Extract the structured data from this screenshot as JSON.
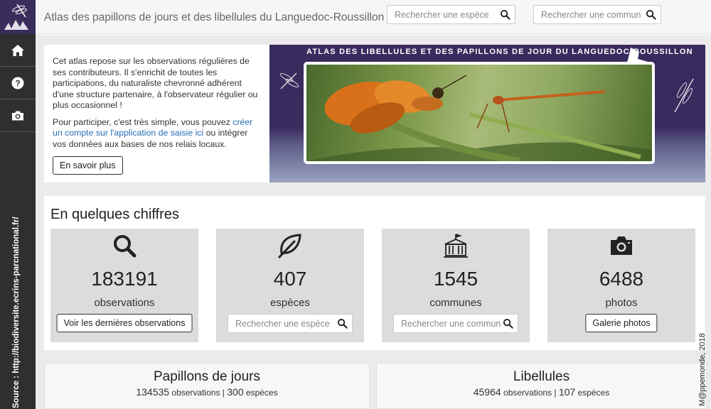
{
  "header": {
    "title": "Atlas des papillons de jours et des libellules du Languedoc-Roussillon",
    "search_species_placeholder": "Rechercher une espèce",
    "search_commune_placeholder": "Rechercher une commune"
  },
  "sidebar": {
    "items": [
      {
        "icon": "home-icon"
      },
      {
        "icon": "help-icon"
      },
      {
        "icon": "camera-icon"
      }
    ],
    "source": "Source : http://biodiversite.ecrins-parcnational.fr/"
  },
  "intro": {
    "p1": "Cet atlas repose sur les observations régulières de ses contributeurs. Il s'enrichit de toutes les participations, du naturaliste chevronné adhérent d'une structure partenaire, à l'observateur régulier ou plus occasionnel !",
    "p2_before": "Pour participer, c'est très simple, vous pouvez ",
    "p2_link": "créer un compte sur l'application de saisie ici",
    "p2_after": " ou intégrer vos données aux bases de nos relais locaux.",
    "button": "En savoir plus"
  },
  "banner": {
    "title": "ATLAS DES LIBELLULES ET DES PAPILLONS DE JOUR DU LANGUEDOC-ROUSSILLON"
  },
  "stats": {
    "title": "En quelques chiffres",
    "cards": [
      {
        "icon": "search-icon",
        "count": "183191",
        "label": "observations",
        "button": "Voir les dernières observations"
      },
      {
        "icon": "leaf-icon",
        "count": "407",
        "label": "espèces",
        "placeholder": "Rechercher une espèce"
      },
      {
        "icon": "town-hall-icon",
        "count": "1545",
        "label": "communes",
        "placeholder": "Rechercher une commune"
      },
      {
        "icon": "camera-icon",
        "count": "6488",
        "label": "photos",
        "button": "Galerie photos"
      }
    ]
  },
  "groups": [
    {
      "title": "Papillons de jours",
      "obs_count": "134535",
      "obs_label": "observations",
      "species_count": "300",
      "species_label": "espèces"
    },
    {
      "title": "Libellules",
      "obs_count": "45964",
      "obs_label": "observations",
      "species_count": "107",
      "species_label": "espèces"
    }
  ],
  "credit": "M@ppemonde, 2018",
  "colors": {
    "sidebar": "#2f2f2f",
    "banner": "#3a2b5e",
    "link": "#2a6db5",
    "card": "#dcdcdc"
  }
}
